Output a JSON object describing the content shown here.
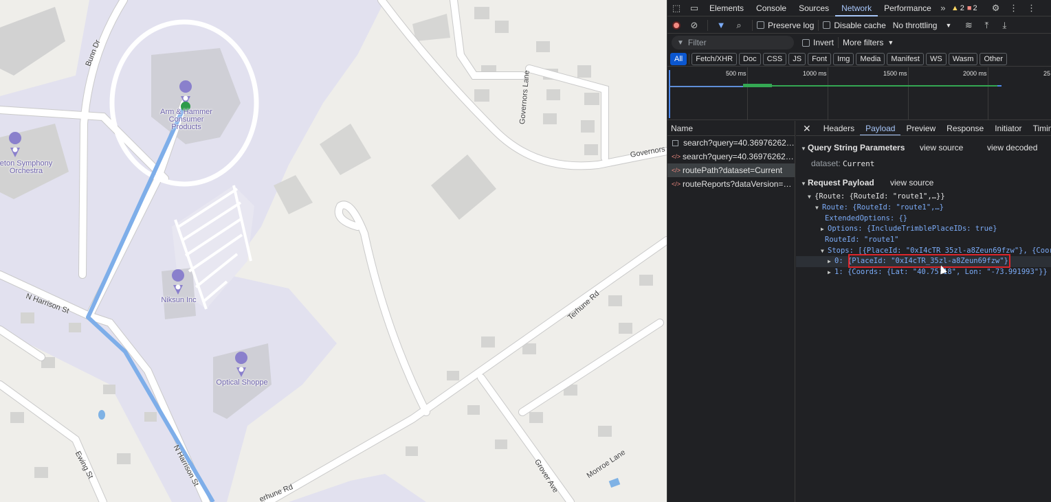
{
  "map": {
    "pois": [
      {
        "name": "Arm & Hammer\nConsumer\nProducts"
      },
      {
        "name": "Niksun Inc"
      },
      {
        "name": "Optical Shoppe"
      },
      {
        "name": "eton Symphony\nOrchestra"
      }
    ],
    "streets": {
      "bunn": "Bunn Dr",
      "governors_lane": "Governors Lane",
      "governors": "Governors",
      "n_harrison_1": "N Harrison St",
      "n_harrison_2": "N Harrison St",
      "terhune_1": "Terhune Rd",
      "terhune_2": "erhune Rd",
      "ewing": "Ewing St",
      "grover": "Grover Ave",
      "monroe": "Monroe Lane"
    },
    "colors": {
      "route": "#7eaee9",
      "campus": "#e1e0ef",
      "poi": "#8a80cc"
    }
  },
  "devtools": {
    "panel_tabs": [
      "Elements",
      "Console",
      "Sources",
      "Network",
      "Performance"
    ],
    "active_tab": "Network",
    "warnings": "2",
    "errors": "2",
    "toolbar": {
      "preserve_log": "Preserve log",
      "disable_cache": "Disable cache",
      "throttling": "No throttling"
    },
    "filter": {
      "placeholder": "Filter",
      "invert": "Invert",
      "more_filters": "More filters"
    },
    "types": [
      "All",
      "Fetch/XHR",
      "Doc",
      "CSS",
      "JS",
      "Font",
      "Img",
      "Media",
      "Manifest",
      "WS",
      "Wasm",
      "Other"
    ],
    "overview_ticks": [
      "500 ms",
      "1000 ms",
      "1500 ms",
      "2000 ms",
      "25"
    ],
    "list_header": "Name",
    "requests": [
      {
        "name": "search?query=40.3697626233...",
        "icon": "doc-icon"
      },
      {
        "name": "search?query=40.3697626233...",
        "icon": "fetch-icon"
      },
      {
        "name": "routePath?dataset=Current",
        "icon": "fetch-icon"
      },
      {
        "name": "routeReports?dataVersion=Cu...",
        "icon": "fetch-icon"
      }
    ],
    "detail_tabs": [
      "Headers",
      "Payload",
      "Preview",
      "Response",
      "Initiator",
      "Timin"
    ],
    "payload": {
      "qs_title": "Query String Parameters",
      "view_source": "view source",
      "view_decoded": "view decoded",
      "qs_key": "dataset:",
      "qs_val": "Current",
      "rp_title": "Request Payload",
      "rp_view_source": "view source",
      "lines": [
        "{Route: {RouteId: \"route1\",…}}",
        "Route: {RouteId: \"route1\",…}",
        "ExtendedOptions: {}",
        "Options: {IncludeTrimblePlaceIDs: true}",
        "RouteId: \"route1\"",
        "Stops: [{PlaceId: \"0xI4cTR_35zl-a8Zeun69fzw\"}, {Coor",
        "0: {PlaceId: \"0xI4cTR_35zl-a8Zeun69fzw\"}",
        "1: {Coords: {Lat: \"40.75?18\", Lon: \"-73.991993\"}}"
      ]
    }
  }
}
